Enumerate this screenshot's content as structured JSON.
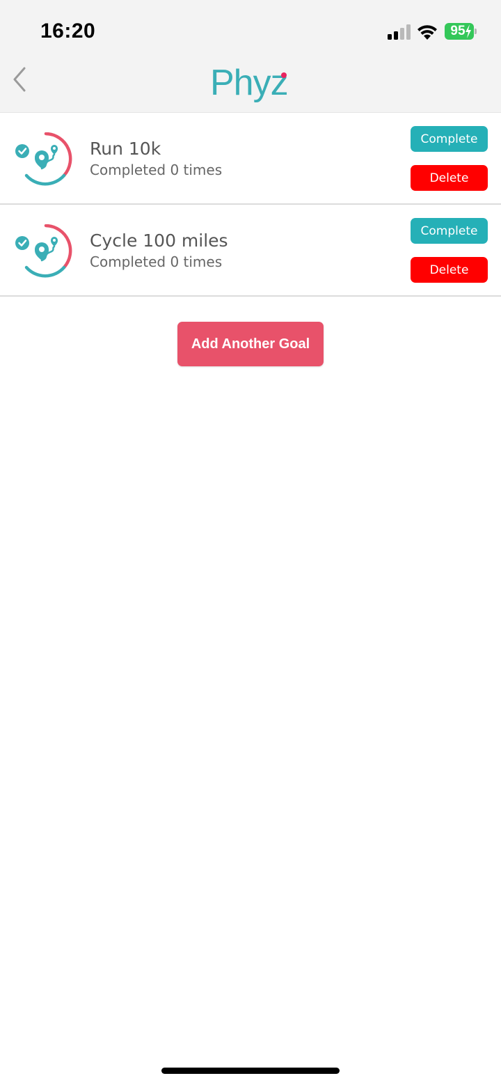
{
  "status_bar": {
    "time": "16:20",
    "battery_level": "95",
    "icons": [
      "signal-icon",
      "wifi-icon",
      "battery-charging-icon"
    ]
  },
  "nav": {
    "logo_text": "Phyz",
    "back_icon": "chevron-left-icon"
  },
  "goals": [
    {
      "title": "Run 10k",
      "subtitle": "Completed 0 times",
      "icon": "goal-route-icon",
      "complete_label": "Complete",
      "delete_label": "Delete"
    },
    {
      "title": "Cycle 100 miles",
      "subtitle": "Completed 0 times",
      "icon": "goal-route-icon",
      "complete_label": "Complete",
      "delete_label": "Delete"
    }
  ],
  "add_goal_label": "Add Another Goal",
  "colors": {
    "teal": "#25b0b7",
    "delete_red": "#ff0000",
    "add_button": "#e8526a",
    "logo_teal": "#3aaeb6",
    "logo_dot": "#e8245f",
    "battery_green": "#34c759"
  }
}
